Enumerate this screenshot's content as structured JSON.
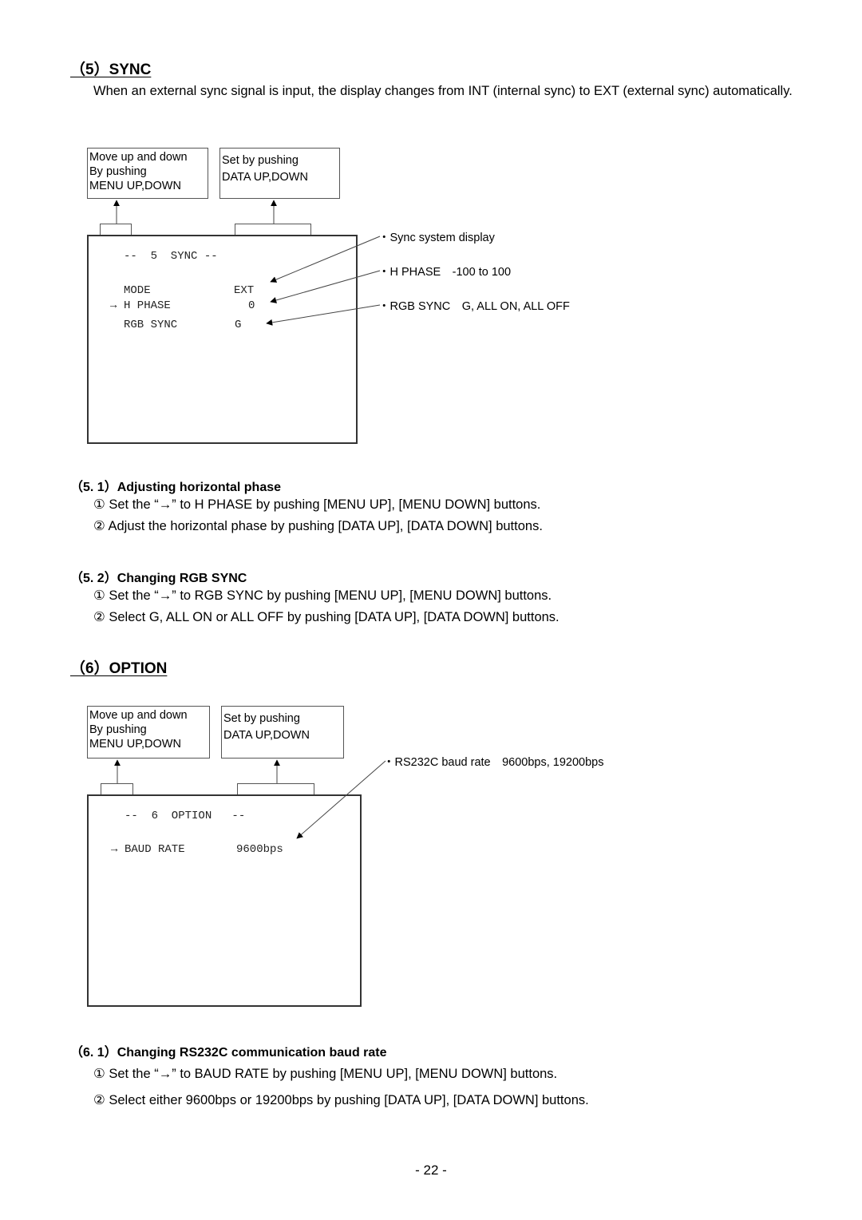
{
  "page_number": "- 22 -",
  "sync": {
    "heading": "（5）SYNC",
    "description": "When an external sync signal is input, the display changes from INT (internal sync) to EXT (external sync) automatically.",
    "callouts": {
      "menu": [
        "Move up and down",
        "By pushing",
        "MENU UP,DOWN"
      ],
      "data": [
        "Set by pushing",
        "DATA UP,DOWN"
      ]
    },
    "screen": {
      "title": "--  5  SYNC --",
      "rows": [
        {
          "cursor": "",
          "label": "MODE",
          "value": "EXT"
        },
        {
          "cursor": "→",
          "label": "H PHASE",
          "value": "0"
        },
        {
          "cursor": "",
          "label": "RGB SYNC",
          "value": "G"
        }
      ]
    },
    "notes": [
      "・Sync system display",
      "・H PHASE　-100 to 100",
      "・RGB SYNC　G, ALL ON, ALL OFF"
    ],
    "subsections": [
      {
        "heading": "（5. 1）Adjusting horizontal phase",
        "steps": [
          "① Set the “→” to H PHASE by pushing [MENU UP], [MENU DOWN] buttons.",
          "② Adjust the horizontal phase by pushing [DATA UP], [DATA DOWN] buttons."
        ]
      },
      {
        "heading": "（5. 2）Changing RGB SYNC",
        "steps": [
          "① Set the “→” to RGB SYNC by pushing [MENU UP], [MENU DOWN] buttons.",
          "② Select G, ALL ON or ALL OFF by pushing [DATA UP], [DATA DOWN] buttons."
        ]
      }
    ]
  },
  "option": {
    "heading": "（6）OPTION",
    "callouts": {
      "menu": [
        "Move up and down",
        "By pushing",
        "MENU UP,DOWN"
      ],
      "data": [
        "Set by pushing",
        "DATA UP,DOWN"
      ]
    },
    "screen": {
      "title": "--  6  OPTION   --",
      "rows": [
        {
          "cursor": "→",
          "label": "BAUD RATE",
          "value": "9600bps"
        }
      ]
    },
    "notes": [
      "・RS232C baud rate　9600bps, 19200bps"
    ],
    "subsections": [
      {
        "heading": "（6. 1）Changing RS232C communication baud rate",
        "steps": [
          "① Set the “→” to BAUD RATE by pushing [MENU UP], [MENU DOWN] buttons.",
          "② Select either 9600bps or 19200bps by pushing [DATA UP], [DATA DOWN] buttons."
        ]
      }
    ]
  }
}
